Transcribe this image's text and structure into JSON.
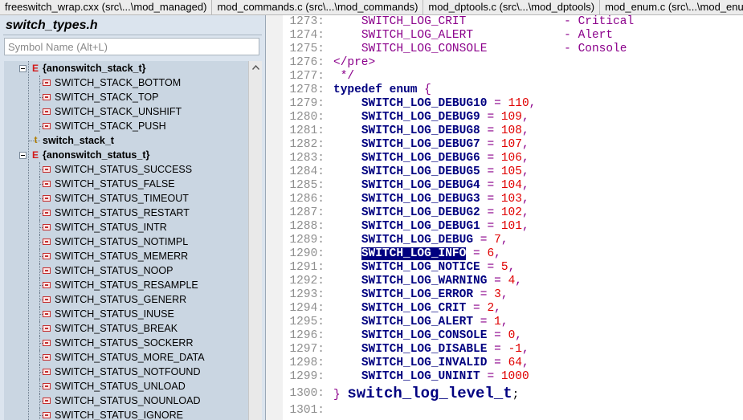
{
  "tabs": [
    {
      "label": "freeswitch_wrap.cxx (src\\...\\mod_managed)"
    },
    {
      "label": "mod_commands.c (src\\...\\mod_commands)"
    },
    {
      "label": "mod_dptools.c (src\\...\\mod_dptools)"
    },
    {
      "label": "mod_enum.c (src\\...\\mod_enum)"
    }
  ],
  "symbols_panel": {
    "title": "switch_types.h",
    "search_placeholder": "Symbol Name (Alt+L)",
    "tree": [
      {
        "type": "enum",
        "label": "{anonswitch_stack_t}"
      },
      {
        "type": "member",
        "label": "SWITCH_STACK_BOTTOM"
      },
      {
        "type": "member",
        "label": "SWITCH_STACK_TOP"
      },
      {
        "type": "member",
        "label": "SWITCH_STACK_UNSHIFT"
      },
      {
        "type": "member",
        "label": "SWITCH_STACK_PUSH"
      },
      {
        "type": "typedef",
        "label": "switch_stack_t"
      },
      {
        "type": "enum",
        "label": "{anonswitch_status_t}"
      },
      {
        "type": "member",
        "label": "SWITCH_STATUS_SUCCESS"
      },
      {
        "type": "member",
        "label": "SWITCH_STATUS_FALSE"
      },
      {
        "type": "member",
        "label": "SWITCH_STATUS_TIMEOUT"
      },
      {
        "type": "member",
        "label": "SWITCH_STATUS_RESTART"
      },
      {
        "type": "member",
        "label": "SWITCH_STATUS_INTR"
      },
      {
        "type": "member",
        "label": "SWITCH_STATUS_NOTIMPL"
      },
      {
        "type": "member",
        "label": "SWITCH_STATUS_MEMERR"
      },
      {
        "type": "member",
        "label": "SWITCH_STATUS_NOOP"
      },
      {
        "type": "member",
        "label": "SWITCH_STATUS_RESAMPLE"
      },
      {
        "type": "member",
        "label": "SWITCH_STATUS_GENERR"
      },
      {
        "type": "member",
        "label": "SWITCH_STATUS_INUSE"
      },
      {
        "type": "member",
        "label": "SWITCH_STATUS_BREAK"
      },
      {
        "type": "member",
        "label": "SWITCH_STATUS_SOCKERR"
      },
      {
        "type": "member",
        "label": "SWITCH_STATUS_MORE_DATA"
      },
      {
        "type": "member",
        "label": "SWITCH_STATUS_NOTFOUND"
      },
      {
        "type": "member",
        "label": "SWITCH_STATUS_UNLOAD"
      },
      {
        "type": "member",
        "label": "SWITCH_STATUS_NOUNLOAD"
      },
      {
        "type": "member",
        "label": "SWITCH_STATUS_IGNORE"
      }
    ]
  },
  "editor": {
    "lines": [
      {
        "n": "1273:",
        "kind": "comment_entry",
        "name": "SWITCH_LOG_CRIT",
        "desc": "- Critical"
      },
      {
        "n": "1274:",
        "kind": "comment_entry",
        "name": "SWITCH_LOG_ALERT",
        "desc": "- Alert"
      },
      {
        "n": "1275:",
        "kind": "comment_entry",
        "name": "SWITCH_LOG_CONSOLE",
        "desc": "- Console"
      },
      {
        "n": "1276:",
        "kind": "comment_text",
        "text": "</pre>"
      },
      {
        "n": "1277:",
        "kind": "comment_text",
        "text": " */"
      },
      {
        "n": "1278:",
        "kind": "typedef",
        "kw": "typedef enum",
        "brace": "{"
      },
      {
        "n": "1279:",
        "kind": "member",
        "name": "SWITCH_LOG_DEBUG10",
        "value": "110",
        "end": ","
      },
      {
        "n": "1280:",
        "kind": "member",
        "name": "SWITCH_LOG_DEBUG9",
        "value": "109",
        "end": ","
      },
      {
        "n": "1281:",
        "kind": "member",
        "name": "SWITCH_LOG_DEBUG8",
        "value": "108",
        "end": ","
      },
      {
        "n": "1282:",
        "kind": "member",
        "name": "SWITCH_LOG_DEBUG7",
        "value": "107",
        "end": ","
      },
      {
        "n": "1283:",
        "kind": "member",
        "name": "SWITCH_LOG_DEBUG6",
        "value": "106",
        "end": ","
      },
      {
        "n": "1284:",
        "kind": "member",
        "name": "SWITCH_LOG_DEBUG5",
        "value": "105",
        "end": ","
      },
      {
        "n": "1285:",
        "kind": "member",
        "name": "SWITCH_LOG_DEBUG4",
        "value": "104",
        "end": ","
      },
      {
        "n": "1286:",
        "kind": "member",
        "name": "SWITCH_LOG_DEBUG3",
        "value": "103",
        "end": ","
      },
      {
        "n": "1287:",
        "kind": "member",
        "name": "SWITCH_LOG_DEBUG2",
        "value": "102",
        "end": ","
      },
      {
        "n": "1288:",
        "kind": "member",
        "name": "SWITCH_LOG_DEBUG1",
        "value": "101",
        "end": ","
      },
      {
        "n": "1289:",
        "kind": "member",
        "name": "SWITCH_LOG_DEBUG",
        "value": "7",
        "end": ","
      },
      {
        "n": "1290:",
        "kind": "member",
        "name": "SWITCH_LOG_INFO",
        "value": "6",
        "end": ",",
        "selected": true
      },
      {
        "n": "1291:",
        "kind": "member",
        "name": "SWITCH_LOG_NOTICE",
        "value": "5",
        "end": ","
      },
      {
        "n": "1292:",
        "kind": "member",
        "name": "SWITCH_LOG_WARNING",
        "value": "4",
        "end": ","
      },
      {
        "n": "1293:",
        "kind": "member",
        "name": "SWITCH_LOG_ERROR",
        "value": "3",
        "end": ","
      },
      {
        "n": "1294:",
        "kind": "member",
        "name": "SWITCH_LOG_CRIT",
        "value": "2",
        "end": ","
      },
      {
        "n": "1295:",
        "kind": "member",
        "name": "SWITCH_LOG_ALERT",
        "value": "1",
        "end": ","
      },
      {
        "n": "1296:",
        "kind": "member",
        "name": "SWITCH_LOG_CONSOLE",
        "value": "0",
        "end": ","
      },
      {
        "n": "1297:",
        "kind": "member",
        "name": "SWITCH_LOG_DISABLE",
        "value": "-1",
        "end": ","
      },
      {
        "n": "1298:",
        "kind": "member",
        "name": "SWITCH_LOG_INVALID",
        "value": "64",
        "end": ","
      },
      {
        "n": "1299:",
        "kind": "member",
        "name": "SWITCH_LOG_UNINIT",
        "value": "1000",
        "end": ""
      },
      {
        "n": "1300:",
        "kind": "close",
        "brace": "}",
        "id": "switch_log_level_t",
        "end": ";"
      },
      {
        "n": "1301:",
        "kind": "empty"
      }
    ]
  },
  "colors": {
    "keyword": "#000080",
    "number": "#e00000",
    "comment": "#8b008b",
    "selection_bg": "#000080",
    "tree_bg": "#cad6e2",
    "panel_bg": "#dbe4ee"
  }
}
